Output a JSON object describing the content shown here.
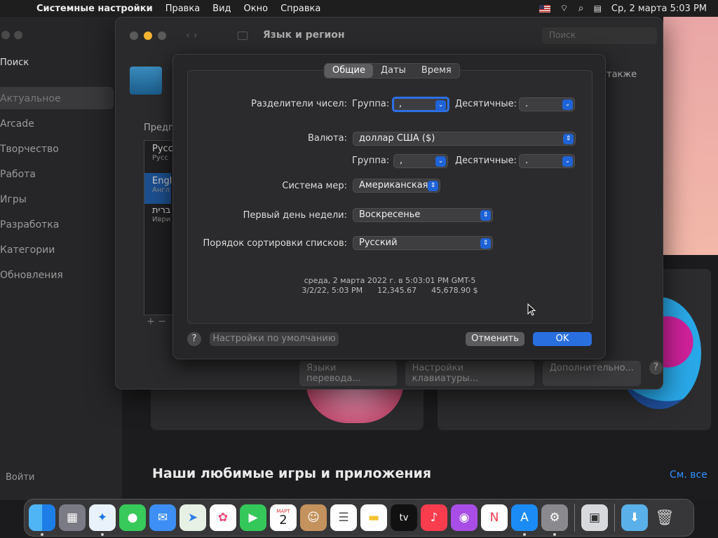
{
  "menubar": {
    "app": "Системные настройки",
    "items": [
      "Правка",
      "Вид",
      "Окно",
      "Справка"
    ],
    "datetime": "Ср, 2 марта  5:03 PM"
  },
  "appstore": {
    "search": "Поиск",
    "items": [
      "Актуальное",
      "Arcade",
      "Творчество",
      "Работа",
      "Игры",
      "Разработка",
      "Категории",
      "Обновления"
    ],
    "bottom": "Войти",
    "section_title": "Наши любимые игры и приложения",
    "see_all": "См. все"
  },
  "prefs": {
    "title": "Язык и регион",
    "search_placeholder": "Поиск",
    "also_text": "также",
    "languages_label": "Предп",
    "languages": [
      {
        "name": "Русс",
        "sub": "Русс"
      },
      {
        "name": "Engl",
        "sub": "Англ"
      },
      {
        "name": "ברית",
        "sub": "Иври"
      }
    ],
    "bottom_buttons": [
      "Языки перевода...",
      "Настройки клавиатуры...",
      "Дополнительно..."
    ]
  },
  "sheet": {
    "tabs": [
      "Общие",
      "Даты",
      "Время"
    ],
    "number_separators_label": "Разделители чисел:",
    "group_label": "Группа:",
    "decimal_label": "Десятичные:",
    "number_group_value": ",",
    "number_decimal_value": ".",
    "currency_label": "Валюта:",
    "currency_value": "доллар США ($)",
    "currency_group_value": ",",
    "currency_decimal_value": ".",
    "measure_label": "Система мер:",
    "measure_value": "Американская",
    "first_day_label": "Первый день недели:",
    "first_day_value": "Воскресенье",
    "sort_label": "Порядок сортировки списков:",
    "sort_value": "Русский",
    "preview_line1": "среда, 2 марта 2022 г. в 5:03:01 PM GMT-5",
    "preview_line2": "3/2/22, 5:03 PM      12,345.67      45,678.90 $",
    "defaults_button": "Настройки по умолчанию",
    "cancel_button": "Отменить",
    "ok_button": "OK",
    "help": "?"
  },
  "dock": {
    "calendar_month": "МАРТ",
    "calendar_day": "2",
    "tv_label": "tv"
  },
  "colors": {
    "accent": "#1f63d6",
    "ok": "#2a6fe0"
  }
}
